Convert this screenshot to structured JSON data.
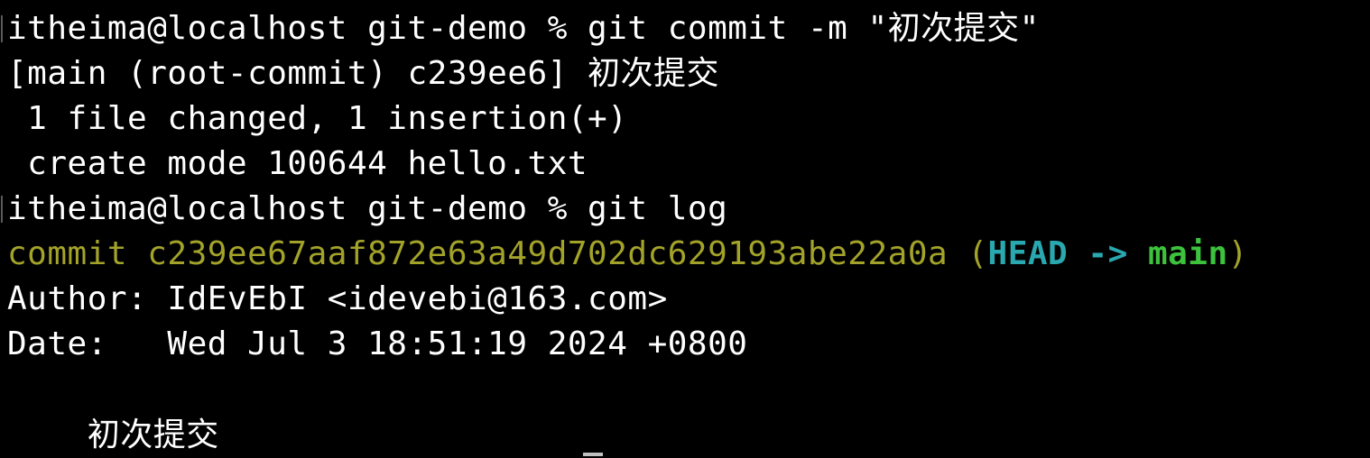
{
  "terminal": {
    "lines": [
      "itheima@localhost git-demo % git commit -m \"初次提交\"",
      "[main (root-commit) c239ee6] 初次提交",
      " 1 file changed, 1 insertion(+)",
      " create mode 100644 hello.txt",
      "itheima@localhost git-demo % git log"
    ],
    "log": {
      "commit_prefix": "commit c239ee67aaf872e63a49d702dc629193abe22a0a",
      "paren_open": " (",
      "head": "HEAD",
      "arrow": " -> ",
      "branch": "main",
      "paren_close": ")",
      "author": "Author: IdEvEbI <idevebi@163.com>",
      "date": "Date:   Wed Jul 3 18:51:19 2024 +0800",
      "message": "    初次提交"
    }
  },
  "colors": {
    "background": "#000000",
    "text": "#ffffff",
    "commit_hash": "#a3a32a",
    "head_ref": "#2aa8b0",
    "branch_ref": "#3cc23c"
  }
}
